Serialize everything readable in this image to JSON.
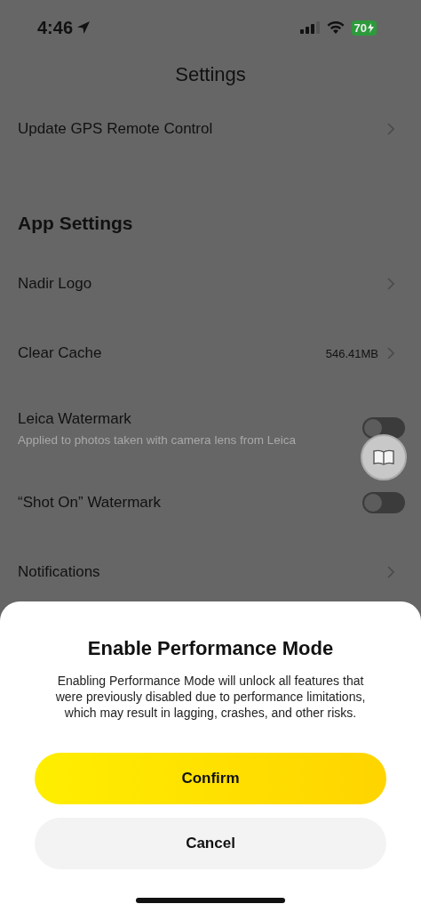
{
  "status_bar": {
    "time": "4:46",
    "battery": "70"
  },
  "title": "Settings",
  "top_items": [
    {
      "kind": "link",
      "label": "Update GPS Remote Control"
    }
  ],
  "section": {
    "heading": "App Settings",
    "items": [
      {
        "kind": "link",
        "label": "Nadir Logo"
      },
      {
        "kind": "value",
        "label": "Clear Cache",
        "value": "546.41MB"
      },
      {
        "kind": "toggle",
        "label": "Leica Watermark",
        "subtitle": "Applied to photos taken with camera lens from Leica",
        "on": false
      },
      {
        "kind": "toggle",
        "label": "“Shot On” Watermark",
        "on": false
      },
      {
        "kind": "link",
        "label": "Notifications"
      }
    ]
  },
  "dialog": {
    "title": "Enable Performance Mode",
    "message": "Enabling Performance Mode will unlock all features that were previously disabled due to performance limitations, which may result in lagging, crashes, and other risks.",
    "buttons": [
      {
        "kind": "primary",
        "label": "Confirm"
      },
      {
        "kind": "secondary",
        "label": "Cancel"
      }
    ]
  }
}
